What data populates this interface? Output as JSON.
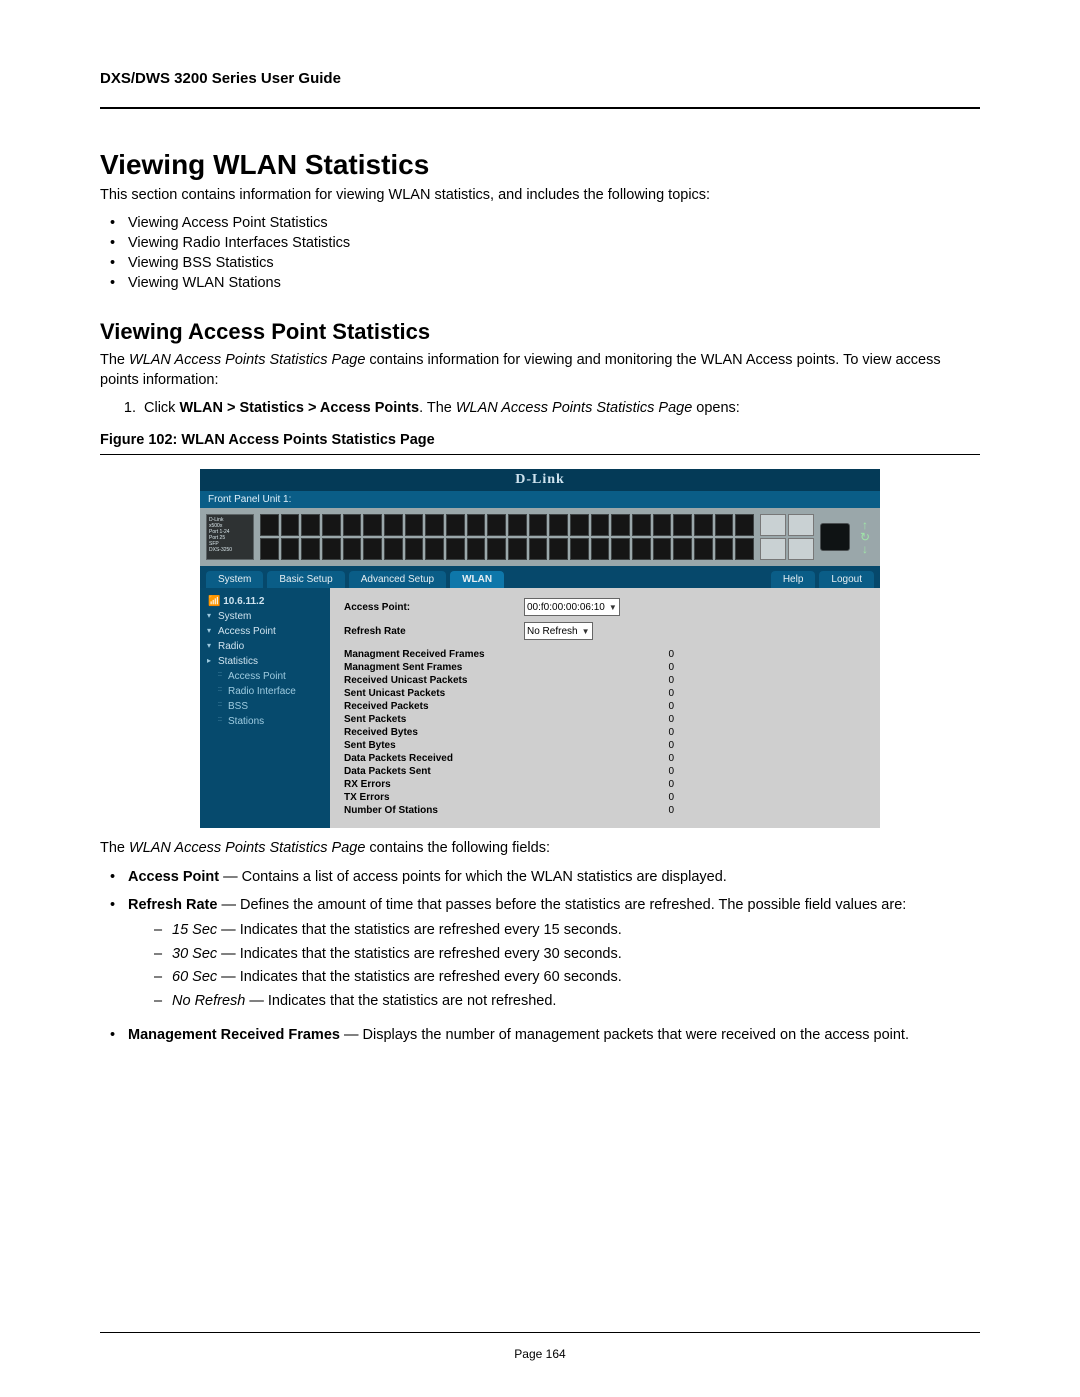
{
  "header": {
    "title": "DXS/DWS 3200 Series User Guide"
  },
  "h1": "Viewing WLAN Statistics",
  "intro": "This section contains information for viewing WLAN statistics, and includes the following topics:",
  "topics": [
    "Viewing Access Point Statistics",
    "Viewing Radio Interfaces Statistics",
    "Viewing BSS Statistics",
    "Viewing WLAN Stations"
  ],
  "h2": "Viewing Access Point Statistics",
  "para2_pre": "The ",
  "para2_ital": "WLAN Access Points Statistics Page",
  "para2_post": " contains information for viewing and monitoring the WLAN Access points. To view access points information:",
  "step1_pre": "Click ",
  "step1_bold": "WLAN > Statistics > Access Points",
  "step1_mid": ".  The ",
  "step1_ital": "WLAN Access Points Statistics Page",
  "step1_post": " opens:",
  "fig_caption": "Figure 102: WLAN Access Points Statistics Page",
  "shot": {
    "brand": "D-Link",
    "panel_label": "Front Panel Unit 1:",
    "left_box_lines": [
      "D-Link",
      "x500x",
      "Port 1-24",
      "Port 25",
      "SFP",
      "DXS-3250"
    ],
    "arrows": {
      "up": "↑",
      "refresh": "↻",
      "down": "↓"
    },
    "tabs": {
      "system": "System",
      "basic": "Basic Setup",
      "advanced": "Advanced Setup",
      "wlan": "WLAN",
      "help": "Help",
      "logout": "Logout"
    },
    "sidebar": {
      "ip": "10.6.11.2",
      "items": [
        {
          "label": "System",
          "class": "sb-item exp"
        },
        {
          "label": "Access Point",
          "class": "sb-item exp"
        },
        {
          "label": "Radio",
          "class": "sb-item exp"
        },
        {
          "label": "Statistics",
          "class": "sb-item"
        },
        {
          "label": "Access Point",
          "class": "sb-sub"
        },
        {
          "label": "Radio Interface",
          "class": "sb-sub"
        },
        {
          "label": "BSS",
          "class": "sb-sub"
        },
        {
          "label": "Stations",
          "class": "sb-sub"
        }
      ]
    },
    "form": {
      "ap_label": "Access Point:",
      "ap_value": "00:f0:00:00:06:10",
      "rr_label": "Refresh Rate",
      "rr_value": "No Refresh"
    },
    "stats": [
      {
        "l": "Managment Received Frames",
        "v": "0"
      },
      {
        "l": "Managment Sent Frames",
        "v": "0"
      },
      {
        "l": "Received Unicast Packets",
        "v": "0"
      },
      {
        "l": "Sent Unicast Packets",
        "v": "0"
      },
      {
        "l": "Received Packets",
        "v": "0"
      },
      {
        "l": "Sent Packets",
        "v": "0"
      },
      {
        "l": "Received Bytes",
        "v": "0"
      },
      {
        "l": "Sent Bytes",
        "v": "0"
      },
      {
        "l": "Data Packets Received",
        "v": "0"
      },
      {
        "l": "Data Packets Sent",
        "v": "0"
      },
      {
        "l": "RX Errors",
        "v": "0"
      },
      {
        "l": "TX Errors",
        "v": "0"
      },
      {
        "l": "Number Of Stations",
        "v": "0"
      }
    ]
  },
  "postfig_pre": "The ",
  "postfig_ital": "WLAN Access Points Statistics Page",
  "postfig_post": " contains the following fields:",
  "fields": {
    "ap": {
      "name": "Access Point",
      "desc": " — Contains a list of access points for which the WLAN statistics are displayed."
    },
    "rr": {
      "name": "Refresh Rate",
      "desc": " — Defines the amount of time that passes before the statistics are refreshed. The possible field values are:"
    },
    "rr_opts": [
      {
        "name": "15 Sec",
        "desc": " — Indicates that the statistics are refreshed every 15 seconds."
      },
      {
        "name": "30 Sec",
        "desc": " — Indicates that the statistics are refreshed every 30 seconds."
      },
      {
        "name": "60 Sec",
        "desc": " — Indicates that the statistics are refreshed every 60 seconds."
      },
      {
        "name": "No Refresh",
        "desc": " — Indicates that the statistics are not refreshed."
      }
    ],
    "mrf": {
      "name": "Management Received Frames",
      "desc": " — Displays the number of management packets that were received on the access point."
    }
  },
  "footer": {
    "page": "Page 164"
  }
}
